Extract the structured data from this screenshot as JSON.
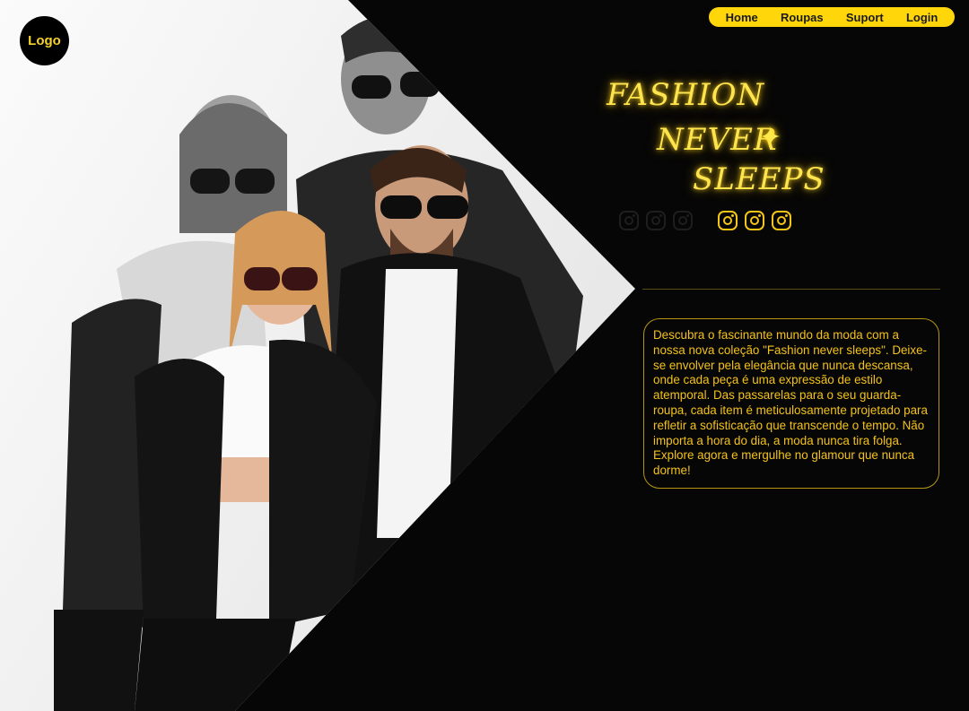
{
  "logo": {
    "label": "Logo"
  },
  "nav": {
    "items": [
      {
        "label": "Home"
      },
      {
        "label": "Roupas"
      },
      {
        "label": "Suport"
      },
      {
        "label": "Login"
      }
    ]
  },
  "hero": {
    "line1": "FASHION",
    "line2": "NEVER",
    "line3": "SLEEPS",
    "star_icon": "sparkle-icon"
  },
  "social": {
    "icons": [
      "instagram-icon",
      "instagram-icon",
      "instagram-icon"
    ]
  },
  "description": {
    "text": "Descubra o fascinante mundo da moda com a nossa nova coleção \"Fashion never sleeps\". Deixe-se envolver pela elegância que nunca descansa, onde cada peça é uma expressão de estilo atemporal. Das passarelas para o seu guarda-roupa, cada item é meticulosamente projetado para refletir a sofisticação que transcende o tempo. Não importa a hora do dia, a moda nunca tira folga. Explore agora e mergulhe no glamour que nunca dorme!"
  },
  "colors": {
    "accent": "#ffd60a",
    "text_accent": "#f4c21a",
    "background": "#060606"
  }
}
